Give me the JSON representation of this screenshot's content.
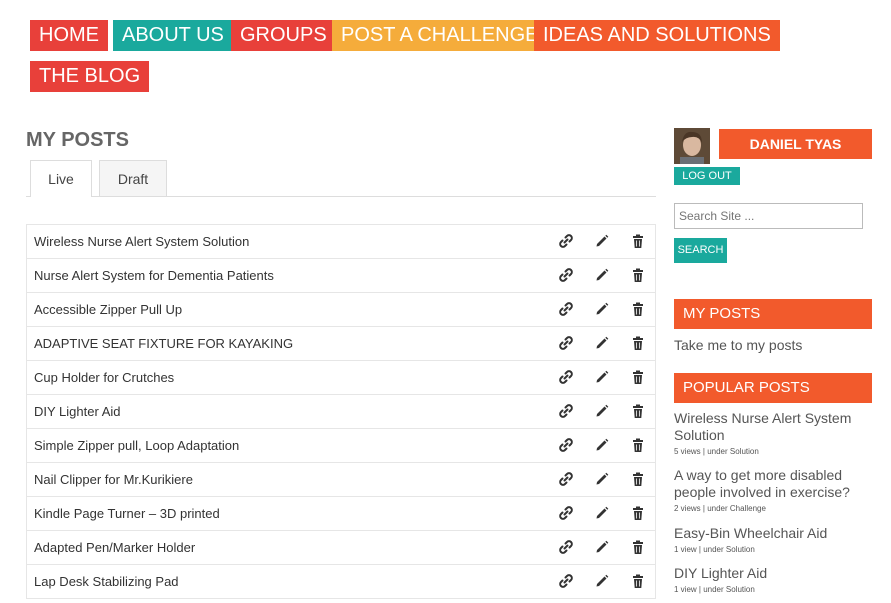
{
  "nav": {
    "home": "HOME",
    "about": "ABOUT US",
    "groups": "GROUPS",
    "post_challenge": "POST A CHALLENGE",
    "ideas": "IDEAS AND SOLUTIONS",
    "blog": "THE BLOG"
  },
  "main": {
    "title": "MY POSTS",
    "tabs": {
      "live": "Live",
      "draft": "Draft"
    },
    "posts": [
      "Wireless Nurse Alert System Solution",
      "Nurse Alert System for Dementia Patients",
      "Accessible Zipper Pull Up",
      "ADAPTIVE SEAT FIXTURE FOR KAYAKING",
      "Cup Holder for Crutches",
      "DIY Lighter Aid",
      "Simple Zipper pull, Loop Adaptation",
      "Nail Clipper for Mr.Kurikiere",
      "Kindle Page Turner – 3D printed",
      "Adapted Pen/Marker Holder",
      "Lap Desk Stabilizing Pad"
    ]
  },
  "sidebar": {
    "user_name": "DANIEL TYAS",
    "logout_label": "LOG OUT",
    "search_placeholder": "Search Site ...",
    "search_button": "SEARCH",
    "my_posts_title": "MY POSTS",
    "my_posts_link": "Take me to my posts",
    "popular_title": "POPULAR POSTS",
    "popular": [
      {
        "title": "Wireless Nurse Alert System Solution",
        "meta": "5 views | under Solution"
      },
      {
        "title": "A way to get more disabled people involved in exercise?",
        "meta": "2 views | under Challenge"
      },
      {
        "title": "Easy-Bin Wheelchair Aid",
        "meta": "1 view | under Solution"
      },
      {
        "title": "DIY Lighter Aid",
        "meta": "1 view | under Solution"
      }
    ]
  },
  "icons": {
    "link": "link-icon",
    "edit": "pencil-icon",
    "delete": "trash-icon"
  },
  "colors": {
    "red": "#e8403a",
    "teal": "#1aa99d",
    "yellow": "#f5ac3b",
    "orange": "#f25a2c"
  }
}
